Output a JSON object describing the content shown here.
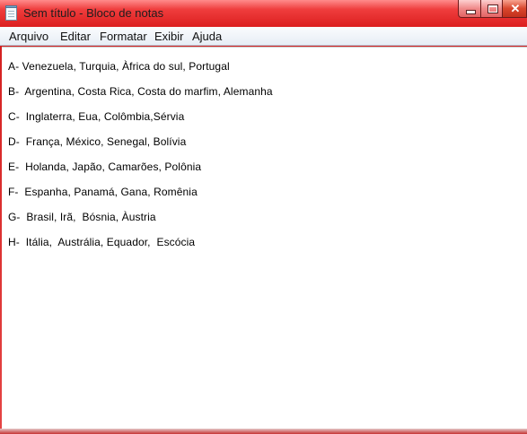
{
  "window": {
    "title": "Sem título - Bloco de notas",
    "icon": "notepad-icon",
    "controls": {
      "minimize": "minimize-icon",
      "maximize": "maximize-icon",
      "close_label": "✕"
    },
    "colors": {
      "frame": "#dc1f1f",
      "menu_bg": "#eef2f8",
      "editor_bg": "#ffffff",
      "text": "#000000"
    }
  },
  "menubar": {
    "items": [
      "Arquivo",
      "Editar",
      "Formatar",
      "Exibir",
      "Ajuda"
    ]
  },
  "document": {
    "lines": [
      "A- Venezuela, Turquia, Àfrica do sul, Portugal",
      "B-  Argentina, Costa Rica, Costa do marfim, Alemanha",
      "C-  Inglaterra, Eua, Colômbia,Sérvia",
      "D-  França, México, Senegal, Bolívia",
      "E-  Holanda, Japão, Camarões, Polônia",
      "F-  Espanha, Panamá, Gana, Romênia",
      "G-  Brasil, Irã,  Bósnia, Àustria",
      "H-  Itália,  Austrália, Equador,  Escócia"
    ]
  }
}
